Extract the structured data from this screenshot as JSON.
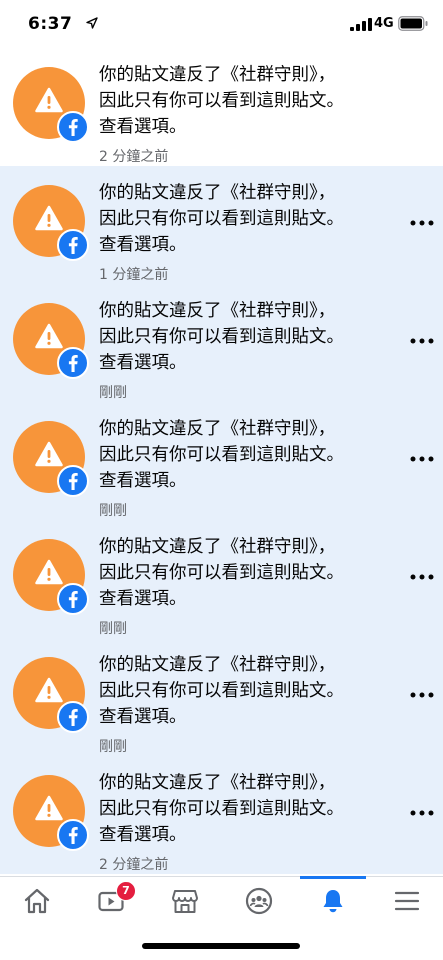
{
  "status_bar": {
    "time": "6:37",
    "network": "4G"
  },
  "notifications": [
    {
      "line1": "你的貼文違反了《社群守則》，",
      "line2": "因此只有你可以看到這則貼文。",
      "line3": "查看選項。",
      "time": "2 分鐘之前",
      "unread": false
    },
    {
      "line1": "你的貼文違反了《社群守則》，",
      "line2": "因此只有你可以看到這則貼文。",
      "line3": "查看選項。",
      "time": "1 分鐘之前",
      "unread": true
    },
    {
      "line1": "你的貼文違反了《社群守則》，",
      "line2": "因此只有你可以看到這則貼文。",
      "line3": "查看選項。",
      "time": "剛剛",
      "unread": true
    },
    {
      "line1": "你的貼文違反了《社群守則》，",
      "line2": "因此只有你可以看到這則貼文。",
      "line3": "查看選項。",
      "time": "剛剛",
      "unread": true
    },
    {
      "line1": "你的貼文違反了《社群守則》，",
      "line2": "因此只有你可以看到這則貼文。",
      "line3": "查看選項。",
      "time": "剛剛",
      "unread": true
    },
    {
      "line1": "你的貼文違反了《社群守則》，",
      "line2": "因此只有你可以看到這則貼文。",
      "line3": "查看選項。",
      "time": "剛剛",
      "unread": true
    },
    {
      "line1": "你的貼文違反了《社群守則》，",
      "line2": "因此只有你可以看到這則貼文。",
      "line3": "查看選項。",
      "time": "2 分鐘之前",
      "unread": true
    }
  ],
  "tab_bar": {
    "tabs": [
      {
        "icon": "home-icon"
      },
      {
        "icon": "watch-icon",
        "badge": "7"
      },
      {
        "icon": "marketplace-icon"
      },
      {
        "icon": "groups-icon"
      },
      {
        "icon": "notifications-icon",
        "active": true
      },
      {
        "icon": "menu-icon"
      }
    ]
  },
  "colors": {
    "accent": "#1877f2",
    "unread_bg": "#e7f0fb",
    "avatar_orange": "#f7953a",
    "badge_red": "#e41e3f"
  }
}
